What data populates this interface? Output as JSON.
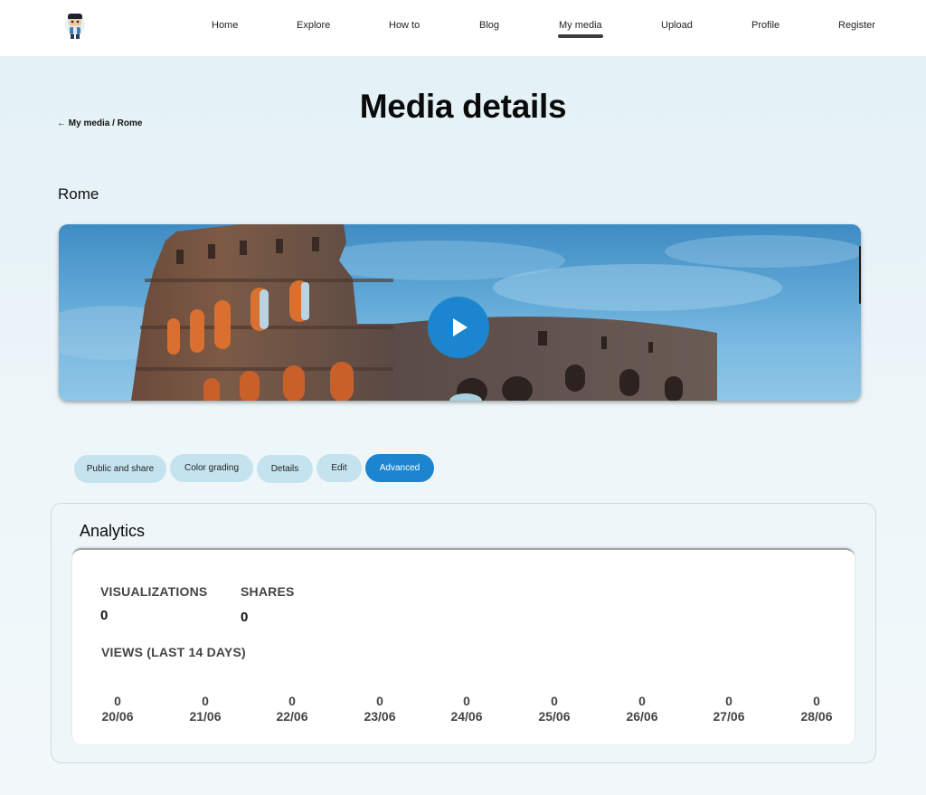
{
  "nav": {
    "items": [
      "Home",
      "Explore",
      "How to",
      "Blog",
      "My media",
      "Upload",
      "Profile",
      "Register"
    ],
    "active": "My media"
  },
  "page": {
    "title": "Media details",
    "breadcrumb": "← My media / Rome",
    "media_name": "Rome"
  },
  "tabs": [
    "Public and share",
    "Color grading",
    "Details",
    "Edit",
    "Advanced"
  ],
  "active_tab": "Advanced",
  "analytics": {
    "title": "Analytics",
    "visualizations_label": "VISUALIZATIONS",
    "visualizations_value": "0",
    "shares_label": "SHARES",
    "shares_value": "0",
    "views_label": "VIEWS (LAST 14 DAYS)",
    "days": [
      {
        "value": "0",
        "date": "20/06"
      },
      {
        "value": "0",
        "date": "21/06"
      },
      {
        "value": "0",
        "date": "22/06"
      },
      {
        "value": "0",
        "date": "23/06"
      },
      {
        "value": "0",
        "date": "24/06"
      },
      {
        "value": "0",
        "date": "25/06"
      },
      {
        "value": "0",
        "date": "26/06"
      },
      {
        "value": "0",
        "date": "27/06"
      },
      {
        "value": "0",
        "date": "28/06"
      }
    ]
  },
  "colors": {
    "accent": "#1b86cf",
    "tab_bg": "#c5e3ee",
    "page_bg": "#e2f0f5"
  },
  "icons": {
    "logo": "avatar-logo-icon",
    "play": "play-icon",
    "back": "arrow-left-icon"
  }
}
